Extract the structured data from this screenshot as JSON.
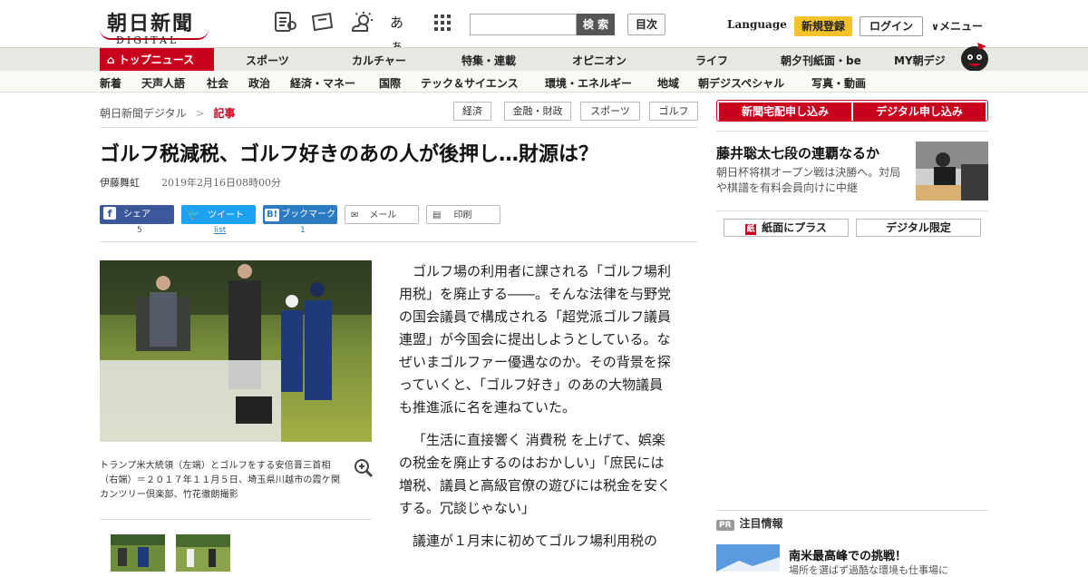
{
  "header": {
    "logo_jp": "朝日新聞",
    "logo_en": "DIGITAL",
    "search_label": "検 索",
    "toc_label": "目次",
    "language_label": "Language",
    "register_label": "新規登録",
    "login_label": "ログイン",
    "menu_label": "メニュー",
    "font_toggle": "あぁ"
  },
  "nav": {
    "top_news": "トップニュース",
    "items": [
      "スポーツ",
      "カルチャー",
      "特集・連載",
      "オピニオン",
      "ライフ",
      "朝夕刊紙面・be",
      "MY朝デジ"
    ]
  },
  "subnav": {
    "items": [
      "新着",
      "天声人語",
      "社会",
      "政治",
      "経済・マネー",
      "国際",
      "テック＆サイエンス",
      "環境・エネルギー",
      "地域",
      "朝デジスペシャル",
      "写真・動画"
    ]
  },
  "breadcrumb": {
    "root": "朝日新聞デジタル",
    "separator": ">",
    "current": "記事"
  },
  "tags": [
    "経済",
    "金融・財政",
    "スポーツ",
    "ゴルフ"
  ],
  "article": {
    "title": "ゴルフ税減税、ゴルフ好きのあの人が後押し…財源は？",
    "author": "伊藤舞虹",
    "date": "2019年2月16日08時00分",
    "share": {
      "share_label": "シェア",
      "share_count": "5",
      "tweet_label": "ツイート",
      "tweet_count": "list",
      "bookmark_label": "ブックマーク",
      "bookmark_count": "1",
      "mail_label": "メール",
      "print_label": "印刷"
    },
    "photo_caption": "トランプ米大統領（左端）とゴルフをする安倍晋三首相（右端）＝２０１７年１１月５日、埼玉県川越市の霞ケ関カンツリー倶楽部、竹花徹朗撮影",
    "paragraphs": [
      "ゴルフ場の利用者に課される「ゴルフ場利用税」を廃止する――。そんな法律を与野党の国会議員で構成される「超党派ゴルフ議員連盟」が今国会に提出しようとしている。なぜいまゴルファー優遇なのか。その背景を探っていくと、「ゴルフ好き」のあの大物議員も推進派に名を連ねていた。",
      "「生活に直接響く 消費税 を上げて、娯楽の税金を廃止するのはおかしい」「庶民には増税、議員と高級官僚の遊びには税金を安くする。冗談じゃない」",
      "議連が１月末に初めてゴルフ場利用税の"
    ]
  },
  "sidebar": {
    "subscribe_paper": "新聞宅配申し込み",
    "subscribe_digital": "デジタル申し込み",
    "feature_title": "藤井聡太七段の連覇なるか",
    "feature_desc": "朝日杯将棋オープン戦は決勝へ。対局や棋譜を有料会員向けに中継",
    "plus_label": "紙面にプラス",
    "digital_only_label": "デジタル限定",
    "pr_badge": "PR",
    "pr_title": "注目情報",
    "pr_head": "南米最高峰での挑戦！",
    "pr_sub": "場所を選ばず過酷な環境も仕事場に"
  },
  "colors": {
    "accent": "#c8001e",
    "register": "#f5c22a",
    "facebook": "#3b5998",
    "twitter": "#1da1f2",
    "hatena": "#2a7bc2"
  }
}
